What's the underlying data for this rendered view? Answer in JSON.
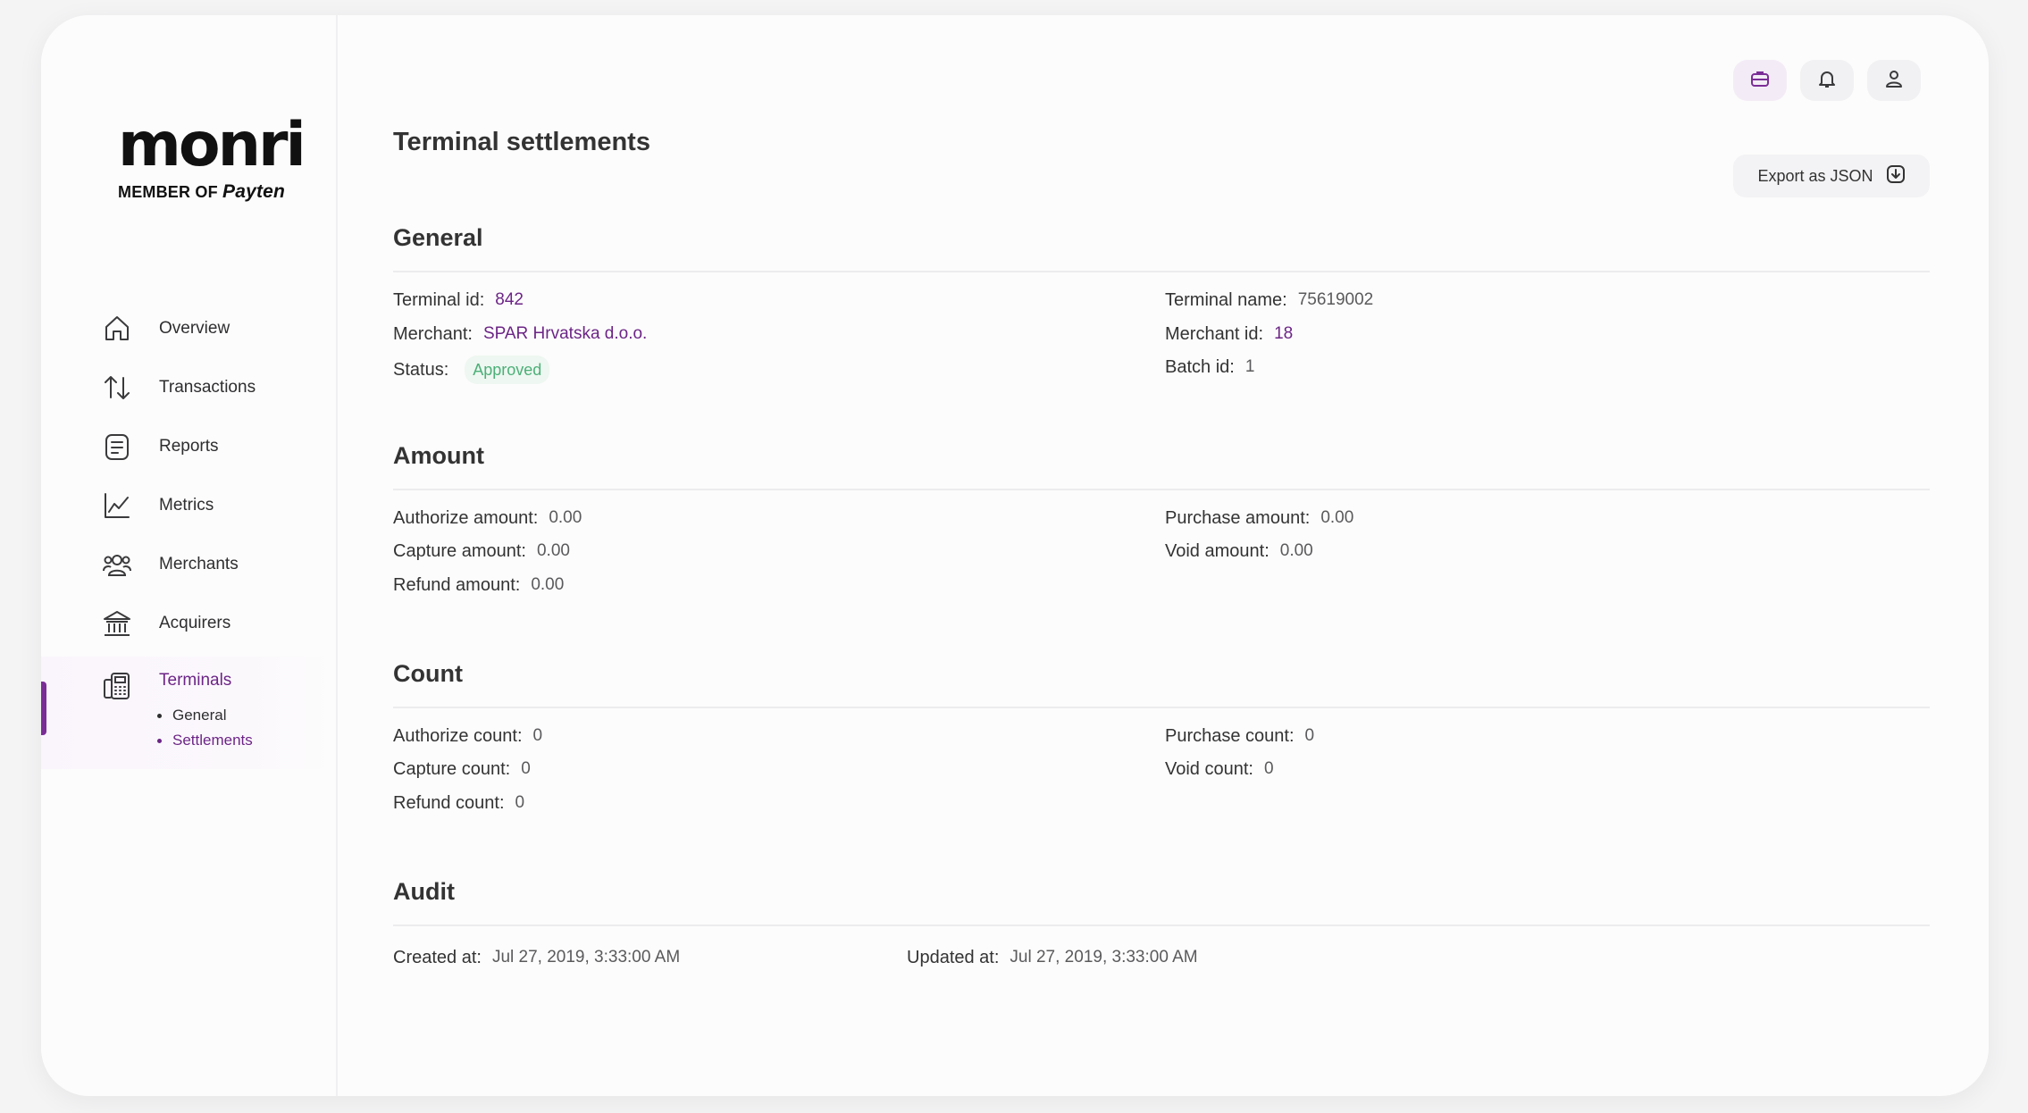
{
  "brand": {
    "name": "monri",
    "tagline_prefix": "MEMBER OF",
    "tagline_brand": "Payten"
  },
  "sidebar": {
    "items": [
      {
        "label": "Overview",
        "icon": "home-icon"
      },
      {
        "label": "Transactions",
        "icon": "transfer-arrows-icon"
      },
      {
        "label": "Reports",
        "icon": "document-icon"
      },
      {
        "label": "Metrics",
        "icon": "line-chart-icon"
      },
      {
        "label": "Merchants",
        "icon": "users-icon"
      },
      {
        "label": "Acquirers",
        "icon": "bank-icon"
      },
      {
        "label": "Terminals",
        "icon": "pos-terminal-icon"
      }
    ],
    "sub_items": [
      {
        "label": "General"
      },
      {
        "label": "Settlements"
      }
    ]
  },
  "topbar": {
    "icons": [
      "briefcase-icon",
      "bell-icon",
      "user-icon"
    ]
  },
  "page": {
    "title": "Terminal settlements",
    "export_label": "Export as JSON"
  },
  "general": {
    "title": "General",
    "terminal_id_label": "Terminal id:",
    "terminal_id": "842",
    "merchant_label": "Merchant:",
    "merchant": "SPAR Hrvatska d.o.o.",
    "status_label": "Status:",
    "status": "Approved",
    "terminal_name_label": "Terminal name:",
    "terminal_name": "75619002",
    "merchant_id_label": "Merchant id:",
    "merchant_id": "18",
    "batch_id_label": "Batch id:",
    "batch_id": "1"
  },
  "amount": {
    "title": "Amount",
    "authorize_label": "Authorize amount:",
    "authorize": "0.00",
    "capture_label": "Capture amount:",
    "capture": "0.00",
    "refund_label": "Refund amount:",
    "refund": "0.00",
    "purchase_label": "Purchase amount:",
    "purchase": "0.00",
    "void_label": "Void amount:",
    "void": "0.00"
  },
  "count": {
    "title": "Count",
    "authorize_label": "Authorize count:",
    "authorize": "0",
    "capture_label": "Capture count:",
    "capture": "0",
    "refund_label": "Refund count:",
    "refund": "0",
    "purchase_label": "Purchase count:",
    "purchase": "0",
    "void_label": "Void count:",
    "void": "0"
  },
  "audit": {
    "title": "Audit",
    "created_label": "Created at:",
    "created": "Jul 27, 2019, 3:33:00 AM",
    "updated_label": "Updated at:",
    "updated": "Jul 27, 2019, 3:33:00 AM"
  },
  "colors": {
    "accent": "#7b2d96",
    "status_approved": "#4caf78"
  }
}
